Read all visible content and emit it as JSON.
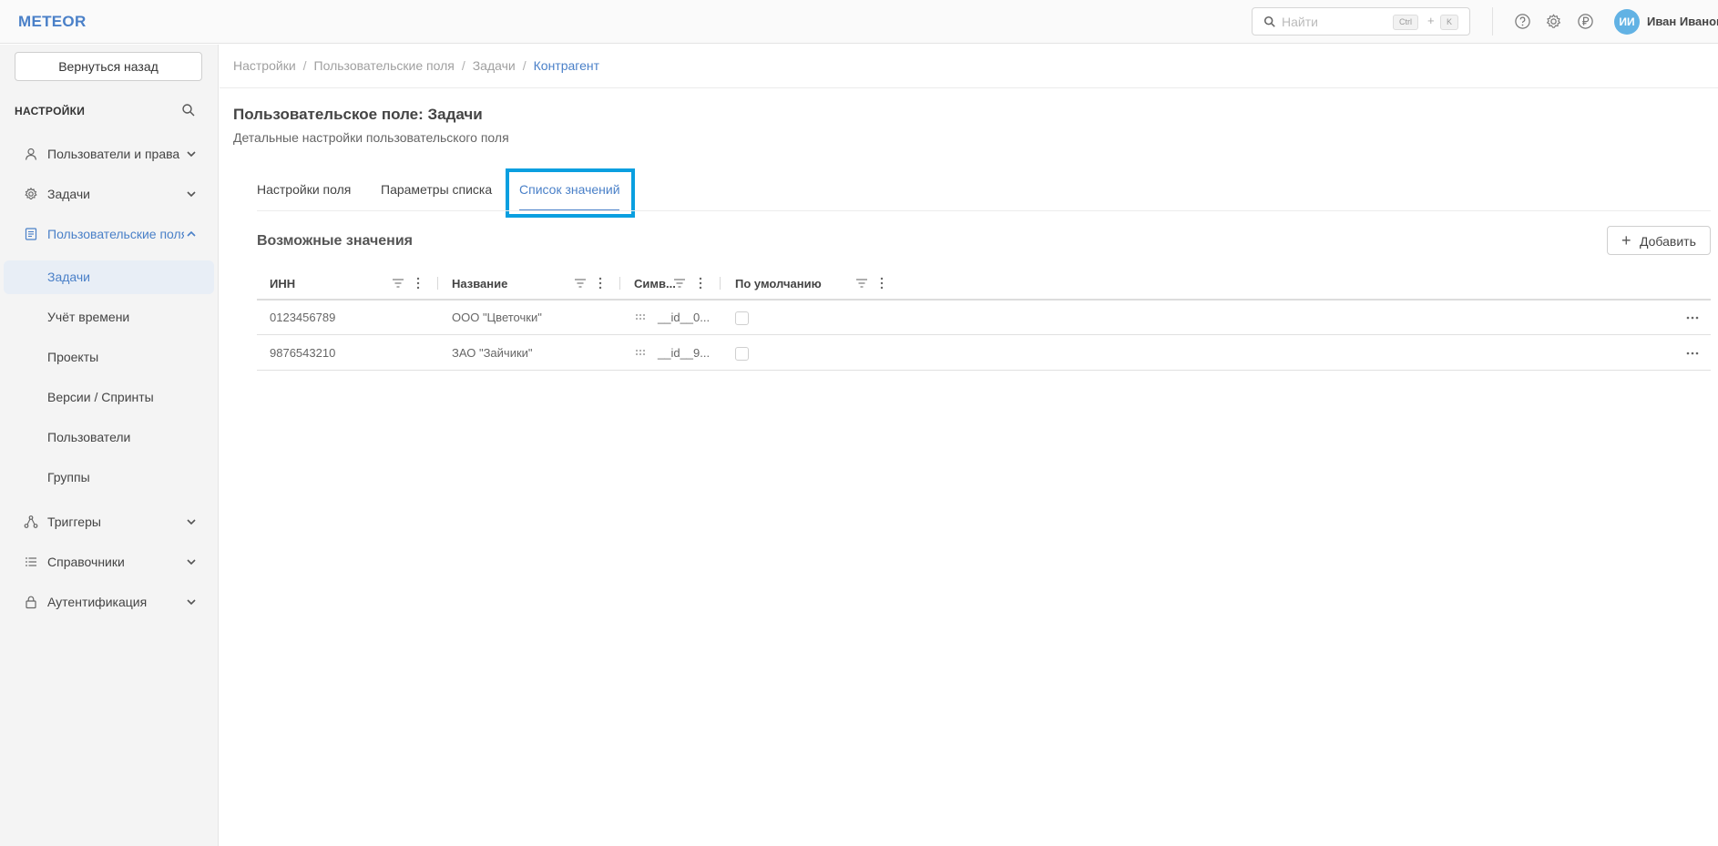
{
  "app": {
    "logo": "METEOR"
  },
  "header": {
    "search_placeholder": "Найти",
    "kbd_ctrl": "Ctrl",
    "kbd_plus": "+",
    "kbd_k": "K",
    "avatar_initials": "ИИ",
    "user_name": "Иван Иванов",
    "icons": [
      "help-icon",
      "gear-icon",
      "ruble-icon"
    ]
  },
  "sidebar": {
    "back_label": "Вернуться назад",
    "title": "НАСТРОЙКИ",
    "items": [
      {
        "label": "Пользователи и права",
        "icon": "user-icon",
        "expanded": false
      },
      {
        "label": "Задачи",
        "icon": "gear-icon",
        "expanded": false
      },
      {
        "label": "Пользовательские поля",
        "icon": "form-icon",
        "expanded": true
      },
      {
        "label": "Триггеры",
        "icon": "triggers-icon",
        "expanded": false
      },
      {
        "label": "Справочники",
        "icon": "list-icon",
        "expanded": false
      },
      {
        "label": "Аутентификация",
        "icon": "lock-icon",
        "expanded": false
      }
    ],
    "sub_items": [
      {
        "label": "Задачи",
        "active": true
      },
      {
        "label": "Учёт времени",
        "active": false
      },
      {
        "label": "Проекты",
        "active": false
      },
      {
        "label": "Версии / Спринты",
        "active": false
      },
      {
        "label": "Пользователи",
        "active": false
      },
      {
        "label": "Группы",
        "active": false
      }
    ]
  },
  "breadcrumbs": [
    "Настройки",
    "Пользовательские поля",
    "Задачи",
    "Контрагент"
  ],
  "page": {
    "title": "Пользовательское поле: Задачи",
    "subtitle": "Детальные настройки пользовательского поля"
  },
  "tabs": [
    {
      "label": "Настройки поля",
      "active": false
    },
    {
      "label": "Параметры списка",
      "active": false
    },
    {
      "label": "Список значений",
      "active": true
    }
  ],
  "values_section": {
    "title": "Возможные значения",
    "add_label": "Добавить",
    "columns": [
      "ИНН",
      "Название",
      "Симв...",
      "По умолчанию"
    ],
    "rows": [
      {
        "inn": "0123456789",
        "name": "ООО \"Цветочки\"",
        "symbol": "__id__0...",
        "default": false
      },
      {
        "inn": "9876543210",
        "name": "ЗАО \"Зайчики\"",
        "symbol": "__id__9...",
        "default": false
      }
    ]
  },
  "colors": {
    "accent": "#4a80c8",
    "highlight": "#0a9fe0",
    "avatar": "#62b2e4"
  }
}
